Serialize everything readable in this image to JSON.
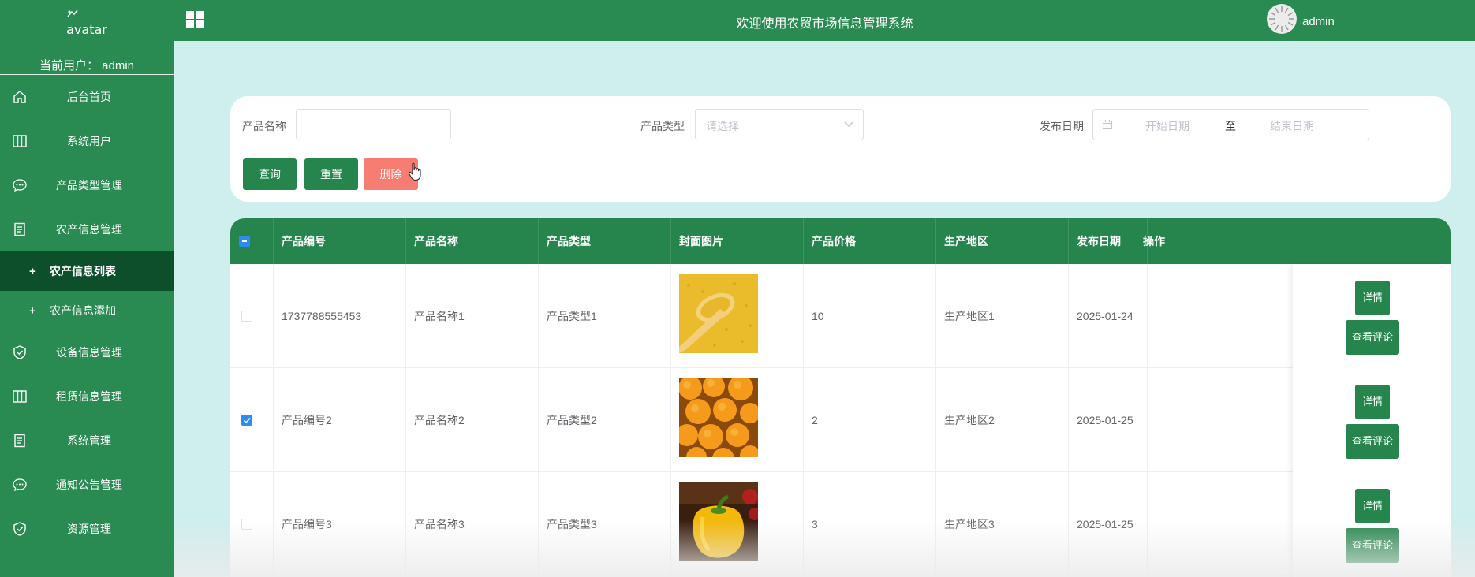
{
  "sidebar": {
    "avatar_alt": "avatar",
    "current_user": "当前用户： admin",
    "menu": [
      {
        "label": "后台首页",
        "icon": "home-icon"
      },
      {
        "label": "系统用户",
        "icon": "columns-icon"
      },
      {
        "label": "产品类型管理",
        "icon": "chat-icon"
      },
      {
        "label": "农产信息管理",
        "icon": "document-icon"
      }
    ],
    "submenu": [
      {
        "label": "农产信息列表",
        "active": true
      },
      {
        "label": "农产信息添加",
        "active": false
      }
    ],
    "menu2": [
      {
        "label": "设备信息管理",
        "icon": "shield-check-icon"
      },
      {
        "label": "租赁信息管理",
        "icon": "columns-icon"
      },
      {
        "label": "系统管理",
        "icon": "document-icon"
      },
      {
        "label": "通知公告管理",
        "icon": "chat-icon"
      },
      {
        "label": "资源管理",
        "icon": "shield-check-icon"
      }
    ]
  },
  "topbar": {
    "title": "欢迎使用农贸市场信息管理系统",
    "username": "admin"
  },
  "search": {
    "name_label": "产品名称",
    "name_value": "",
    "type_label": "产品类型",
    "type_placeholder": "请选择",
    "date_label": "发布日期",
    "date_start_placeholder": "开始日期",
    "date_sep": "至",
    "date_end_placeholder": "结束日期",
    "query_btn": "查询",
    "reset_btn": "重置",
    "delete_btn": "删除"
  },
  "table": {
    "columns": [
      "产品编号",
      "产品名称",
      "产品类型",
      "封面图片",
      "产品价格",
      "生产地区",
      "发布日期",
      "操作"
    ],
    "rows": [
      {
        "id": "1737788555453",
        "name": "产品名称1",
        "type": "产品类型1",
        "image": "millet",
        "price": "10",
        "region": "生产地区1",
        "date": "2025-01-24",
        "checked": false
      },
      {
        "id": "产品编号2",
        "name": "产品名称2",
        "type": "产品类型2",
        "image": "oranges",
        "price": "2",
        "region": "生产地区2",
        "date": "2025-01-25",
        "checked": true
      },
      {
        "id": "产品编号3",
        "name": "产品名称3",
        "type": "产品类型3",
        "image": "pepper",
        "price": "3",
        "region": "生产地区3",
        "date": "2025-01-25",
        "checked": false
      }
    ],
    "detail_btn": "详情",
    "comment_btn": "查看评论"
  },
  "colors": {
    "brand_green": "#2a8b52",
    "active_menu": "#0d4f2a",
    "delete_red": "#f77d72",
    "page_bg": "#cfeeee"
  }
}
